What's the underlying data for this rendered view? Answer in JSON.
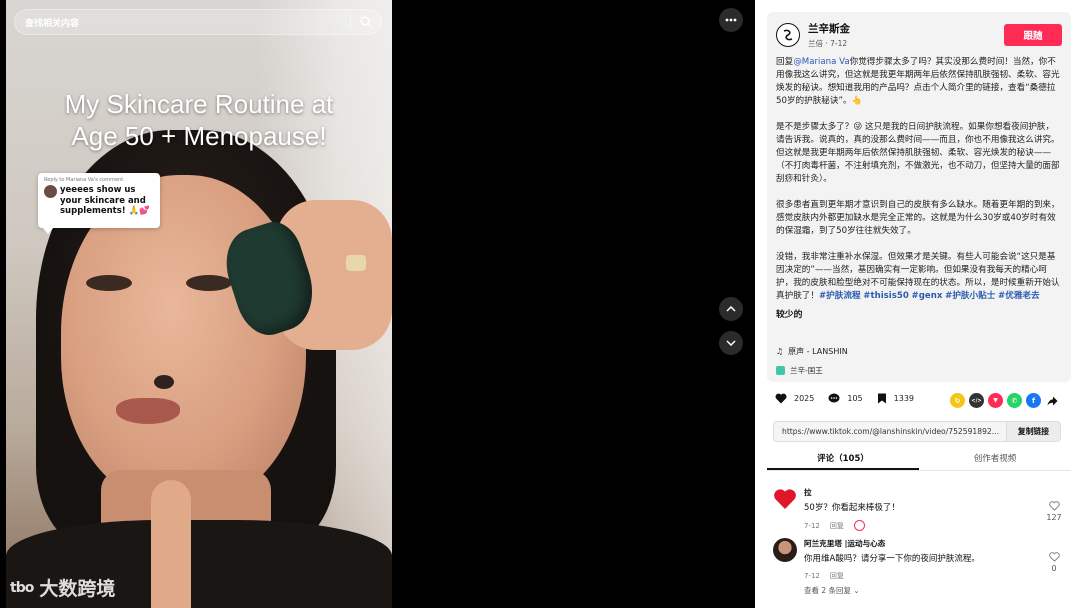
{
  "search": {
    "placeholder": "查找相关内容"
  },
  "video": {
    "title_line1": "My Skincare Routine at",
    "title_line2": "Age 50 + Menopause!",
    "reply_card": {
      "header": "Reply to Mariana Va's comment",
      "text": "yeeees show us your skincare and supplements! 🙏💕"
    },
    "watermark": {
      "logo": "tbo",
      "text": "大数跨境"
    }
  },
  "author": {
    "name": "兰辛斯金",
    "meta": "兰倍 · 7-12",
    "follow_label": "跟随"
  },
  "description": {
    "p1_prefix": "回复",
    "p1_mention": "@Mariana Va",
    "p1_rest": "你觉得步骤太多了吗？其实没那么费时间！当然，你不用像我这么讲究，但这就是我更年期两年后依然保持肌肤强韧、柔软、容光焕发的秘诀。想知道我用的产品吗？点击个人简介里的链接，查看“桑德拉50岁的护肤秘诀”。👆",
    "p2": "是不是步骤太多了？😜 这只是我的日间护肤流程。如果你想看夜间护肤，请告诉我。说真的，真的没那么费时间——而且，你也不用像我这么讲究。但这就是我更年期两年后依然保持肌肤强韧、柔软、容光焕发的秘诀——（不打肉毒杆菌，不注射填充剂，不做激光，也不动刀，但坚持大量的面部刮痧和针灸）。",
    "p3": "很多患者直到更年期才意识到自己的皮肤有多么缺水。随着更年期的到来，感觉皮肤内外都更加缺水是完全正常的。这就是为什么30岁或40岁时有效的保湿霜，到了50岁往往就失效了。",
    "p4": "没错，我非常注重补水保湿。但效果才是关键。有些人可能会说“这只是基因决定的”——当然，基因确实有一定影响。但如果没有我每天的精心呵护，我的皮肤和脸型绝对不可能保持现在的状态。所以，是时候重新开始认真护肤了！",
    "tags": [
      "#护肤流程",
      "#thisis50",
      "#genx",
      "#护肤小贴士",
      "#优雅老去"
    ],
    "less_label": "较少的"
  },
  "music": {
    "label": "原声 - LANSHIN"
  },
  "effect": {
    "label": "兰辛-国王"
  },
  "stats": {
    "likes": "2025",
    "comments": "105",
    "saves": "1339"
  },
  "share_icons": [
    {
      "name": "repost-icon",
      "color": "#f5c518",
      "glyph": "↻"
    },
    {
      "name": "embed-icon",
      "color": "#333333",
      "glyph": "</>"
    },
    {
      "name": "send-icon",
      "color": "#fe2c55",
      "glyph": "▼"
    },
    {
      "name": "whatsapp-icon",
      "color": "#25d366",
      "glyph": "✆"
    },
    {
      "name": "facebook-icon",
      "color": "#1877f2",
      "glyph": "f"
    }
  ],
  "link": {
    "url": "https://www.tiktok.com/@lanshinskin/video/752591892...",
    "copy_label": "复制链接"
  },
  "tabs": {
    "comments": "评论（105）",
    "creator_videos": "创作者视频"
  },
  "comments": [
    {
      "name": "拉",
      "text": "50岁？你看起来棒极了！",
      "date": "7-12",
      "reply": "回复",
      "likes": "127"
    },
    {
      "name": "阿兰克里塔 |运动与心态",
      "text": "你用维A酸吗？请分享一下你的夜间护肤流程。",
      "date": "7-12",
      "reply": "回复",
      "likes": "0"
    }
  ],
  "view_replies": "查看 2 条回复 ⌄"
}
